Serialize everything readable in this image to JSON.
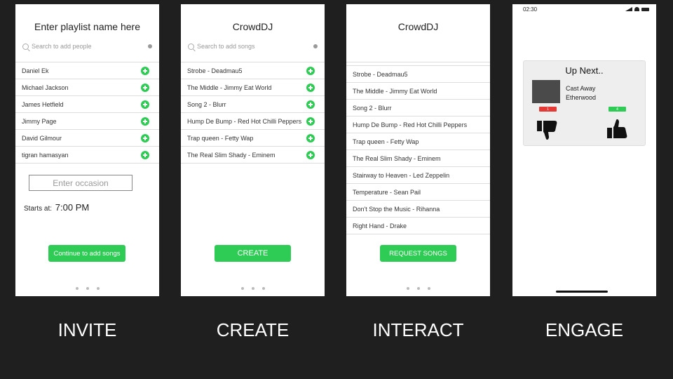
{
  "screens": {
    "invite": {
      "title": "Enter playlist name here",
      "search_placeholder": "Search to add people",
      "people": [
        "Daniel Ek",
        "Michael Jackson",
        "James Hetfield",
        "Jimmy Page",
        "David Gilmour",
        "tigran hamasyan"
      ],
      "occasion_placeholder": "Enter occasion",
      "starts_label": "Starts at:",
      "starts_time": "7:00 PM",
      "continue_button": "Continue to add songs"
    },
    "create": {
      "title": "CrowdDJ",
      "search_placeholder": "Search to add songs",
      "songs": [
        "Strobe - Deadmau5",
        "The Middle - Jimmy Eat World",
        "Song 2 - Blurr",
        "Hump De Bump - Red Hot Chilli Peppers",
        "Trap queen - Fetty Wap",
        "The Real Slim Shady - Eminem"
      ],
      "create_button": "CREATE"
    },
    "interact": {
      "title": "CrowdDJ",
      "songs": [
        "Strobe - Deadmau5",
        "The Middle - Jimmy Eat World",
        "Song 2 - Blurr",
        "Hump De Bump - Red Hot Chilli Peppers",
        "Trap queen - Fetty Wap",
        "The Real Slim Shady - Eminem",
        "Stairway to Heaven - Led Zeppelin",
        "Temperature - Sean Pail",
        "Don't Stop the Music - Rihanna",
        "Right Hand - Drake"
      ],
      "request_button": "REQUEST SONGS"
    },
    "engage": {
      "status_time": "02:30",
      "up_next": "Up Next..",
      "song_title": "Cast Away",
      "song_artist": "Etherwood",
      "down_count": "1",
      "up_count": "4"
    }
  },
  "captions": [
    "INVITE",
    "CREATE",
    "INTERACT",
    "ENGAGE"
  ],
  "colors": {
    "accent": "#2ecc55",
    "downvote": "#e53935",
    "background": "#1f1f1f"
  },
  "icons": [
    "search-icon",
    "clear-icon",
    "plus-icon",
    "thumbs-down-icon",
    "thumbs-up-icon"
  ]
}
